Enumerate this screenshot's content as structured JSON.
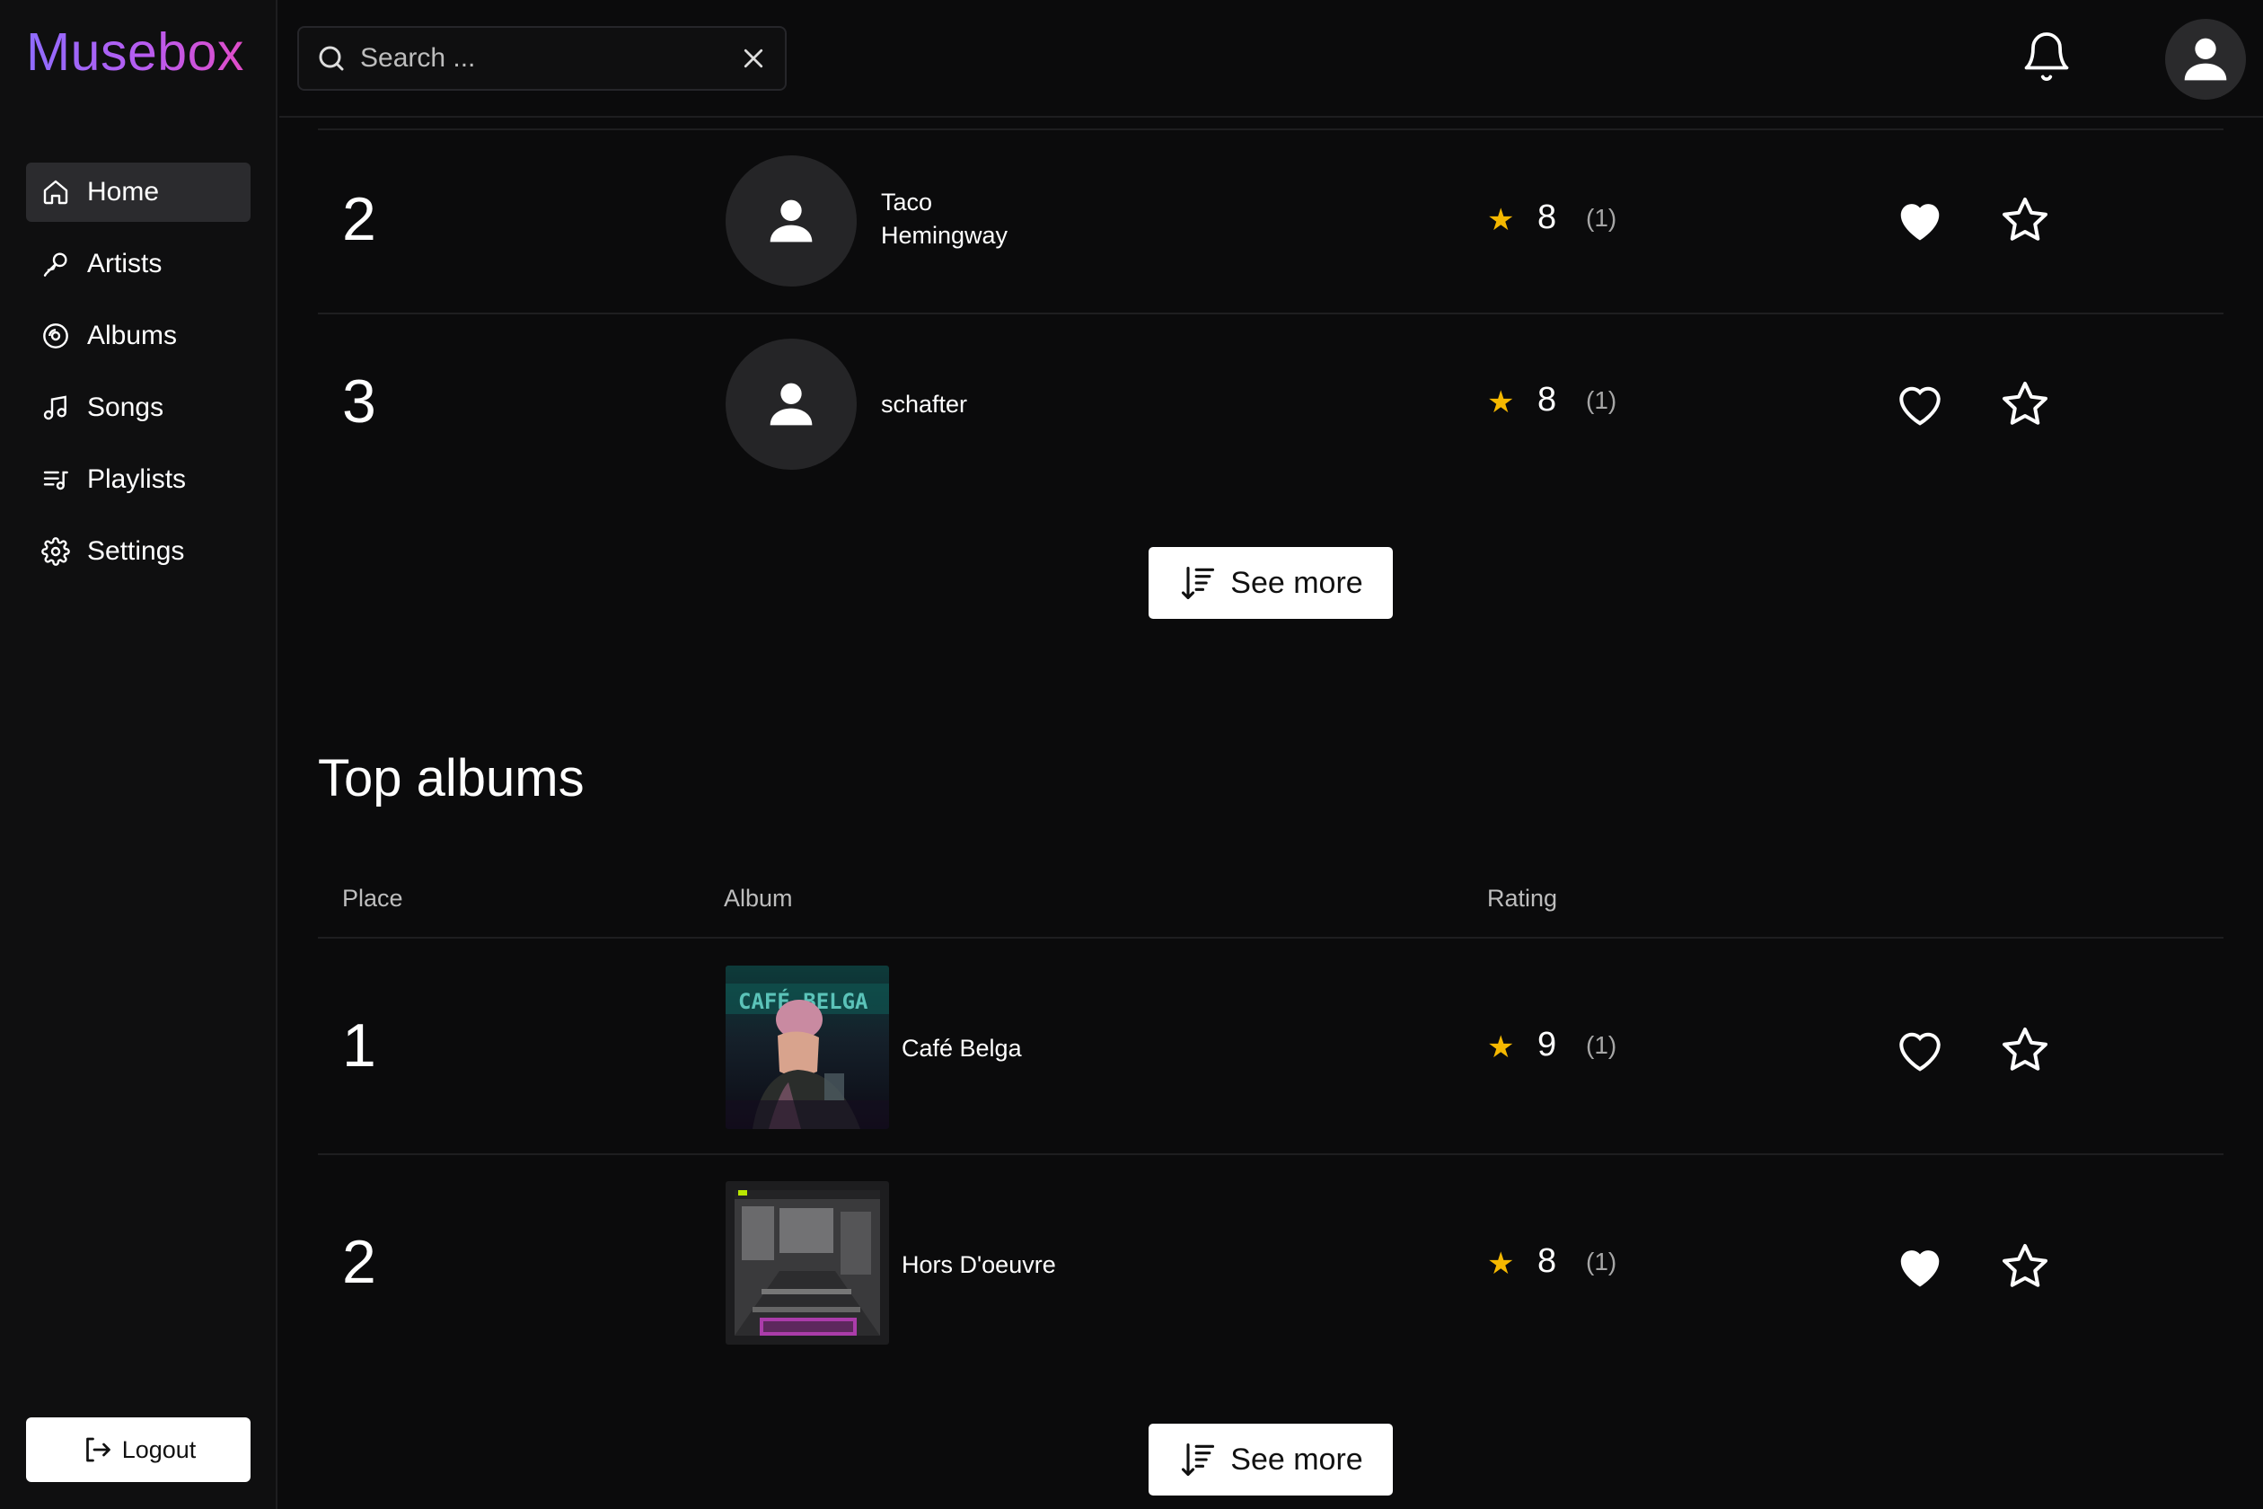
{
  "app": {
    "logo": "Musebox"
  },
  "sidebar": {
    "items": [
      {
        "label": "Home",
        "icon": "home-icon",
        "active": true
      },
      {
        "label": "Artists",
        "icon": "microphone-icon",
        "active": false
      },
      {
        "label": "Albums",
        "icon": "disc-icon",
        "active": false
      },
      {
        "label": "Songs",
        "icon": "music-note-icon",
        "active": false
      },
      {
        "label": "Playlists",
        "icon": "playlist-icon",
        "active": false
      },
      {
        "label": "Settings",
        "icon": "gear-icon",
        "active": false
      }
    ],
    "logout_label": "Logout"
  },
  "header": {
    "search": {
      "placeholder": "Search ...",
      "value": ""
    }
  },
  "top_artists": {
    "rows": [
      {
        "place": "2",
        "name_line1": "Taco",
        "name_line2": "Hemingway",
        "rating": "8",
        "count": "(1)",
        "liked": true,
        "favorited": false
      },
      {
        "place": "3",
        "name": "schafter",
        "rating": "8",
        "count": "(1)",
        "liked": false,
        "favorited": false
      }
    ],
    "see_more_label": "See more"
  },
  "top_albums": {
    "title": "Top albums",
    "columns": {
      "place": "Place",
      "album": "Album",
      "rating": "Rating"
    },
    "rows": [
      {
        "place": "1",
        "name": "Café Belga",
        "rating": "9",
        "count": "(1)",
        "liked": false,
        "favorited": false
      },
      {
        "place": "2",
        "name": "Hors D'oeuvre",
        "rating": "8",
        "count": "(1)",
        "liked": true,
        "favorited": false
      }
    ],
    "see_more_label": "See more"
  },
  "colors": {
    "rating_star": "#f5b800",
    "logo_gradient_start": "#8f6cff",
    "logo_gradient_end": "#e04cc8"
  }
}
